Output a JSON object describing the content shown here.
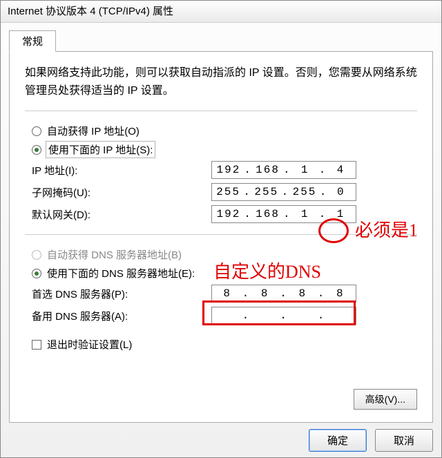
{
  "title": "Internet 协议版本 4 (TCP/IPv4) 属性",
  "tab": {
    "label": "常规"
  },
  "desc": "如果网络支持此功能，则可以获取自动指派的 IP 设置。否则，您需要从网络系统管理员处获得适当的 IP 设置。",
  "ip_section": {
    "radio_auto": "自动获得 IP 地址(O)",
    "radio_manual": "使用下面的 IP 地址(S):",
    "ip_label": "IP 地址(I):",
    "ip": [
      "192",
      "168",
      "1",
      "4"
    ],
    "mask_label": "子网掩码(U):",
    "mask": [
      "255",
      "255",
      "255",
      "0"
    ],
    "gw_label": "默认网关(D):",
    "gw": [
      "192",
      "168",
      "1",
      "1"
    ]
  },
  "dns_section": {
    "radio_auto": "自动获得 DNS 服务器地址(B)",
    "radio_manual": "使用下面的 DNS 服务器地址(E):",
    "pref_label": "首选 DNS 服务器(P):",
    "pref": [
      "8",
      "8",
      "8",
      "8"
    ],
    "alt_label": "备用 DNS 服务器(A):",
    "alt": [
      "",
      "",
      "",
      ""
    ]
  },
  "validate_label": "退出时验证设置(L)",
  "advanced_label": "高级(V)...",
  "ok_label": "确定",
  "cancel_label": "取消",
  "annotations": {
    "must_be_1": "必须是1",
    "custom_dns": "自定义的DNS"
  }
}
